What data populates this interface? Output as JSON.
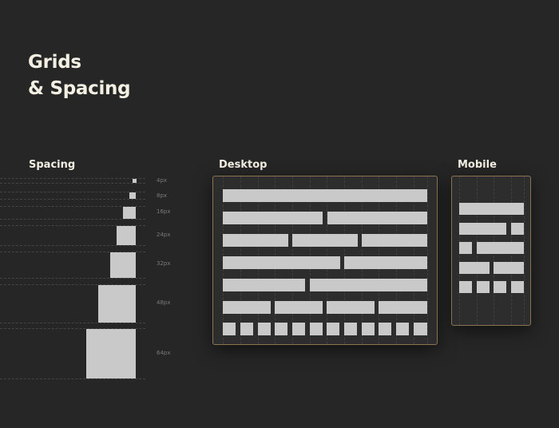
{
  "title": {
    "line1": "Grids",
    "line2": "& Spacing"
  },
  "spacing": {
    "label": "Spacing",
    "items": [
      {
        "label": "4px",
        "value": 4
      },
      {
        "label": "8px",
        "value": 8
      },
      {
        "label": "16px",
        "value": 16
      },
      {
        "label": "24px",
        "value": 24
      },
      {
        "label": "32px",
        "value": 32
      },
      {
        "label": "48px",
        "value": 48
      },
      {
        "label": "64px",
        "value": 64
      }
    ]
  },
  "desktop": {
    "label": "Desktop"
  },
  "mobile": {
    "label": "Mobile"
  },
  "colors": {
    "background": "#262626",
    "panel": "#2d2d2d",
    "panel_border": "#8a7550",
    "block": "#c9c9c9",
    "title": "#f3efe3",
    "muted_label": "#7a7a7a"
  }
}
